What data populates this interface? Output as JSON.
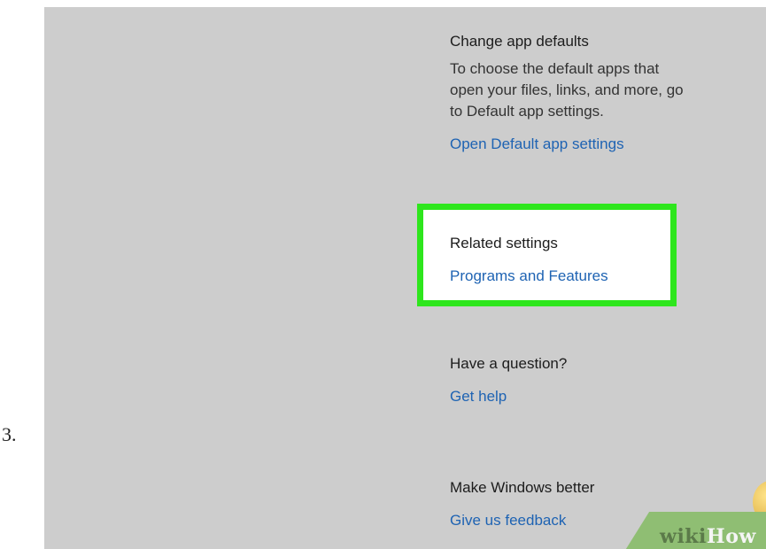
{
  "step_number": "3.",
  "sections": {
    "change_defaults": {
      "heading": "Change app defaults",
      "description": "To choose the default apps that\nopen your files, links, and more, go\nto Default app settings.",
      "link": "Open Default app settings"
    },
    "related": {
      "heading": "Related settings",
      "link": "Programs and Features"
    },
    "question": {
      "heading": "Have a question?",
      "link": "Get help"
    },
    "better": {
      "heading": "Make Windows better",
      "link": "Give us feedback"
    }
  },
  "watermark": {
    "wiki": "wiki",
    "how": "How"
  },
  "colors": {
    "link": "#1e63b3",
    "highlight": "#2ee61d",
    "panel": "#cdcdcd"
  }
}
